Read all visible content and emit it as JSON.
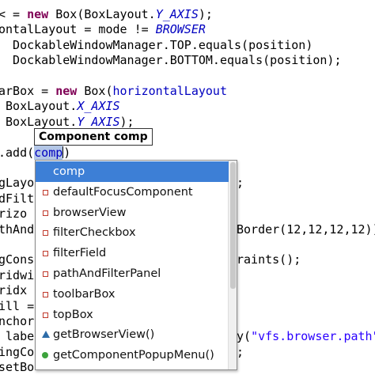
{
  "code_lines": [
    {
      "segments": [
        {
          "t": "< = ",
          "c": ""
        },
        {
          "t": "new",
          "c": "kw"
        },
        {
          "t": " Box(BoxLayout.",
          "c": ""
        },
        {
          "t": "Y_AXIS",
          "c": "ital"
        },
        {
          "t": ");",
          "c": ""
        }
      ]
    },
    {
      "segments": [
        {
          "t": "ontalLayout = mode != ",
          "c": ""
        },
        {
          "t": "BROWSER",
          "c": "ital"
        }
      ]
    },
    {
      "segments": [
        {
          "t": "  DockableWindowManager.TOP.equals(position)",
          "c": ""
        }
      ]
    },
    {
      "segments": [
        {
          "t": "  DockableWindowManager.BOTTOM.equals(position);",
          "c": ""
        }
      ]
    },
    {
      "segments": [
        {
          "t": "",
          "c": ""
        }
      ]
    },
    {
      "segments": [
        {
          "t": "arBox = ",
          "c": ""
        },
        {
          "t": "new",
          "c": "kw"
        },
        {
          "t": " Box(",
          "c": ""
        },
        {
          "t": "horizontalLayout",
          "c": "fld"
        }
      ]
    },
    {
      "segments": [
        {
          "t": " BoxLayout.",
          "c": ""
        },
        {
          "t": "X_AXIS",
          "c": "ital"
        }
      ]
    },
    {
      "segments": [
        {
          "t": " BoxLayout.",
          "c": ""
        },
        {
          "t": "Y_AXIS",
          "c": "ital"
        },
        {
          "t": ");",
          "c": ""
        }
      ]
    },
    {
      "segments": [
        {
          "t": "",
          "c": ""
        }
      ]
    },
    {
      "segments": [
        {
          "t": ".add(",
          "c": ""
        },
        {
          "t": "comp",
          "c": "sel"
        },
        {
          "t": ")",
          "c": ""
        }
      ]
    },
    {
      "segments": [
        {
          "t": "",
          "c": ""
        }
      ]
    },
    {
      "segments": [
        {
          "t": "gLayo",
          "c": ""
        }
      ]
    },
    {
      "segments": [
        {
          "t": "dFilt",
          "c": ""
        }
      ]
    },
    {
      "segments": [
        {
          "t": "rizo",
          "c": ""
        }
      ]
    },
    {
      "segments": [
        {
          "t": "thAnd",
          "c": ""
        }
      ]
    },
    {
      "segments": [
        {
          "t": "",
          "c": ""
        }
      ]
    },
    {
      "segments": [
        {
          "t": "gCons",
          "c": ""
        }
      ]
    },
    {
      "segments": [
        {
          "t": "ridwi",
          "c": ""
        }
      ]
    },
    {
      "segments": [
        {
          "t": "ridx",
          "c": ""
        }
      ]
    },
    {
      "segments": [
        {
          "t": "ill =",
          "c": ""
        }
      ]
    },
    {
      "segments": [
        {
          "t": "nchor",
          "c": ""
        }
      ]
    },
    {
      "segments": [
        {
          "t": " labe",
          "c": ""
        }
      ]
    },
    {
      "segments": [
        {
          "t": "ingCo",
          "c": ""
        }
      ]
    },
    {
      "segments": [
        {
          "t": "setBo",
          "c": ""
        }
      ]
    }
  ],
  "right_fragments": [
    {
      "row": 11,
      "text": ";"
    },
    {
      "row": 14,
      "text": "Border(12,12,12,12));"
    },
    {
      "row": 16,
      "text": "raints();"
    },
    {
      "row": 21,
      "text_pre": "y(",
      "str": "\"vfs.browser.path\"",
      "text_post": ")"
    },
    {
      "row": 22,
      "text": ";"
    }
  ],
  "tooltip": "Component comp",
  "popup": {
    "items": [
      {
        "label": "comp",
        "icon": "local-variable-icon",
        "selected": true
      },
      {
        "label": "defaultFocusComponent",
        "icon": "field-icon",
        "selected": false
      },
      {
        "label": "browserView",
        "icon": "field-icon",
        "selected": false
      },
      {
        "label": "filterCheckbox",
        "icon": "field-icon",
        "selected": false
      },
      {
        "label": "filterField",
        "icon": "field-icon",
        "selected": false
      },
      {
        "label": "pathAndFilterPanel",
        "icon": "field-icon",
        "selected": false
      },
      {
        "label": "toolbarBox",
        "icon": "field-icon",
        "selected": false
      },
      {
        "label": "topBox",
        "icon": "field-icon",
        "selected": false
      },
      {
        "label": "getBrowserView()",
        "icon": "public-method-icon",
        "selected": false
      },
      {
        "label": "getComponentPopupMenu()",
        "icon": "method-icon",
        "selected": false
      }
    ]
  },
  "colors": {
    "keyword": "#7f0055",
    "field": "#0000c0",
    "string": "#2a00ff",
    "selection": "#3d7fd6"
  }
}
